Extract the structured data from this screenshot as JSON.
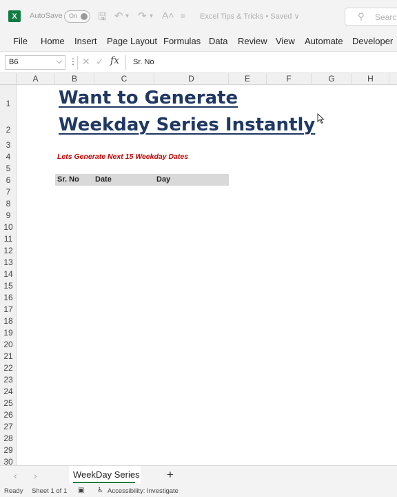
{
  "titlebar": {
    "app_icon": "X",
    "autosave_label": "AutoSave",
    "autosave_state": "On",
    "doc_title": "Excel Tips & Tricks • Saved ∨",
    "search_label": "Search"
  },
  "ribbon": {
    "items": [
      "File",
      "Home",
      "Insert",
      "Page Layout",
      "Formulas",
      "Data",
      "Review",
      "View",
      "Automate",
      "Developer"
    ]
  },
  "formula_bar": {
    "name_box": "B6",
    "content": "Sr. No",
    "fx_label": "fx"
  },
  "columns": [
    "A",
    "B",
    "C",
    "D",
    "E",
    "F",
    "G",
    "H"
  ],
  "rows": [
    "1",
    "2",
    "3",
    "4",
    "5",
    "6",
    "7",
    "8",
    "9",
    "10",
    "11",
    "12",
    "13",
    "14",
    "15",
    "16",
    "17",
    "18",
    "19",
    "20",
    "21",
    "22",
    "23",
    "24",
    "25",
    "26",
    "27",
    "28",
    "29",
    "30"
  ],
  "sheet": {
    "title_line1": "Want to Generate",
    "title_line2": "Weekday Series Instantly",
    "subtitle": "Lets Generate Next 15 Weekday Dates",
    "headers": [
      "Sr. No",
      "Date",
      "Day"
    ]
  },
  "tabs": {
    "active": "WeekDay Series",
    "add": "+"
  },
  "statusbar": {
    "ready": "Ready",
    "sheet_info": "Sheet 1 of 1",
    "accessibility": "Accessibility: Investigate"
  },
  "colors": {
    "excel_green": "#107c41",
    "title_navy": "#1f3864",
    "subtitle_red": "#c00000",
    "header_fill": "#d9d9d9"
  }
}
